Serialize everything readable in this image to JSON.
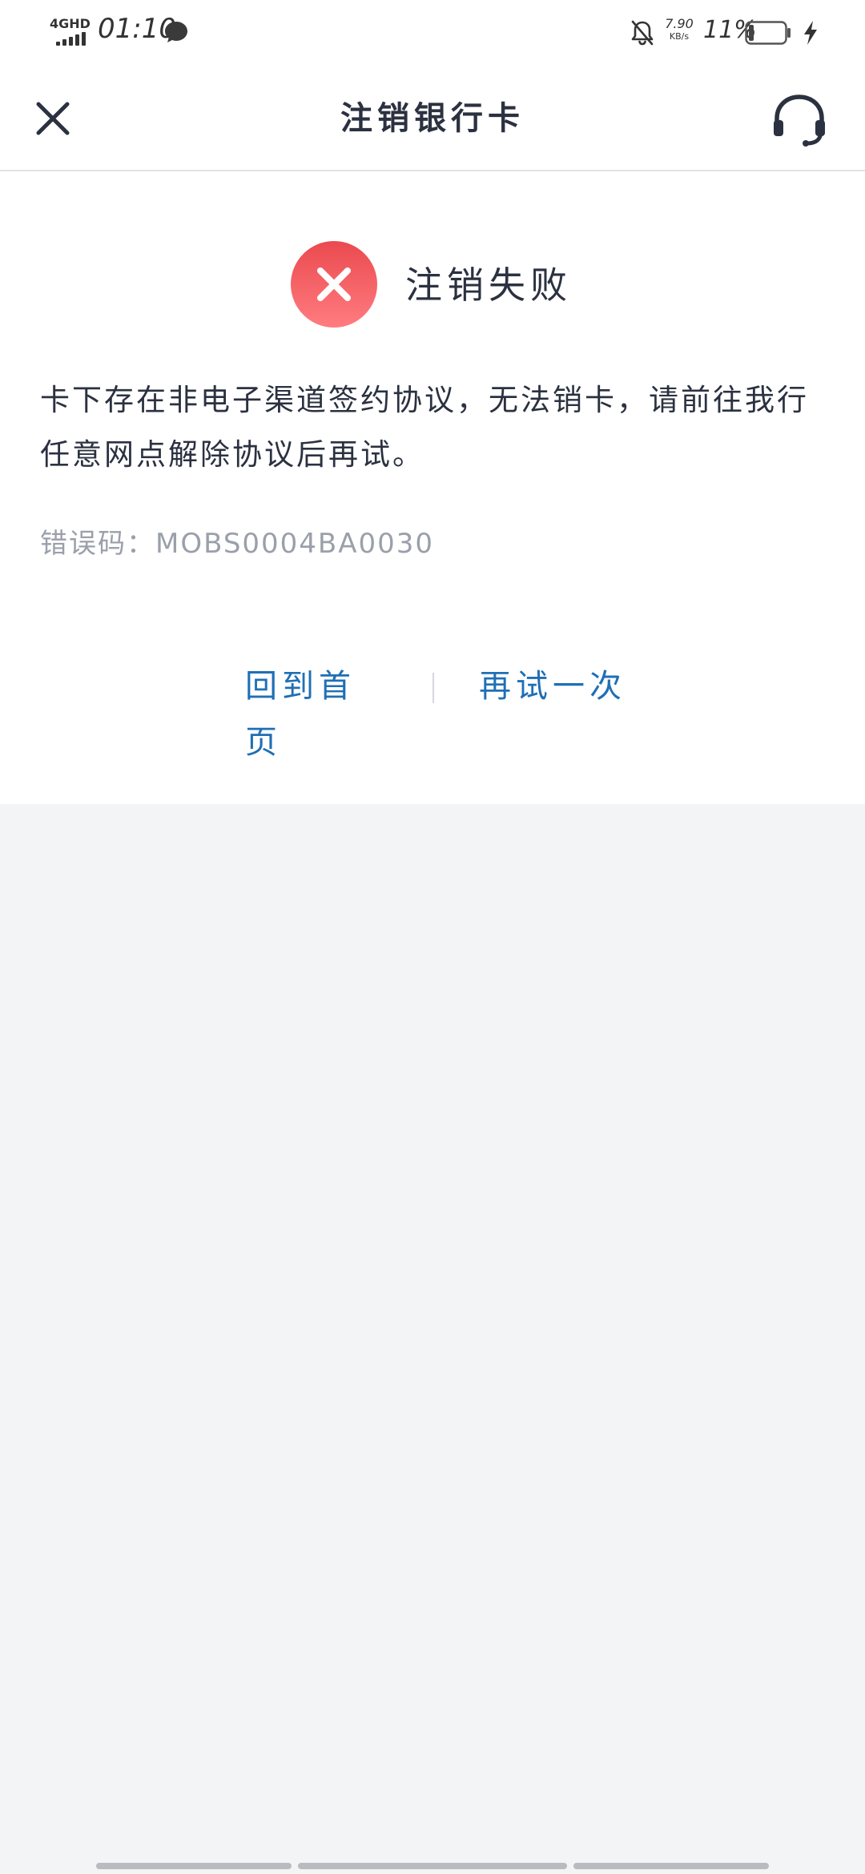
{
  "status_bar": {
    "network": "4GHD",
    "time": "01:10",
    "net_speed_value": "7.90",
    "net_speed_unit": "KB/s",
    "battery_percent": "11%",
    "battery_level": 0.11
  },
  "header": {
    "title": "注销银行卡",
    "close_icon": "close-icon",
    "service_icon": "headset-icon"
  },
  "result": {
    "status_icon": "error-x-icon",
    "status_color": "#f0575c",
    "title": "注销失败",
    "message": "卡下存在非电子渠道签约协议，无法销卡，请前往我行任意网点解除协议后再试。",
    "error_code": "错误码：MOBS0004BA0030"
  },
  "actions": {
    "home_label": "回到首页",
    "retry_label": "再试一次",
    "link_color": "#1f6fb5"
  }
}
